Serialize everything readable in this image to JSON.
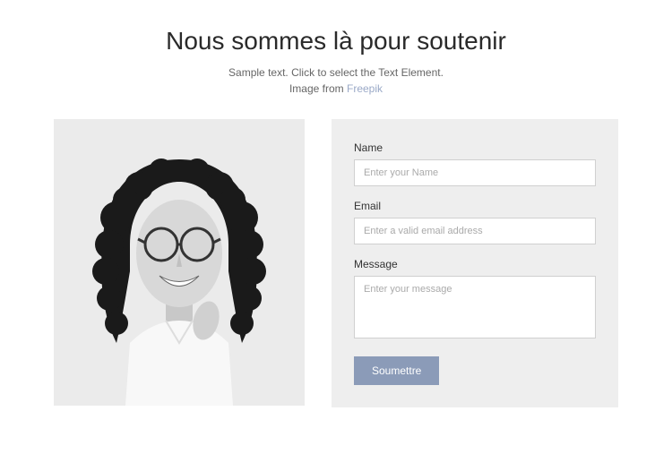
{
  "header": {
    "title": "Nous sommes là pour soutenir",
    "subtitle_line1": "Sample text. Click to select the Text Element.",
    "subtitle_line2_prefix": "Image from ",
    "subtitle_link_text": "Freepik"
  },
  "form": {
    "name": {
      "label": "Name",
      "placeholder": "Enter your Name"
    },
    "email": {
      "label": "Email",
      "placeholder": "Enter a valid email address"
    },
    "message": {
      "label": "Message",
      "placeholder": "Enter your message"
    },
    "submit_label": "Soumettre"
  }
}
